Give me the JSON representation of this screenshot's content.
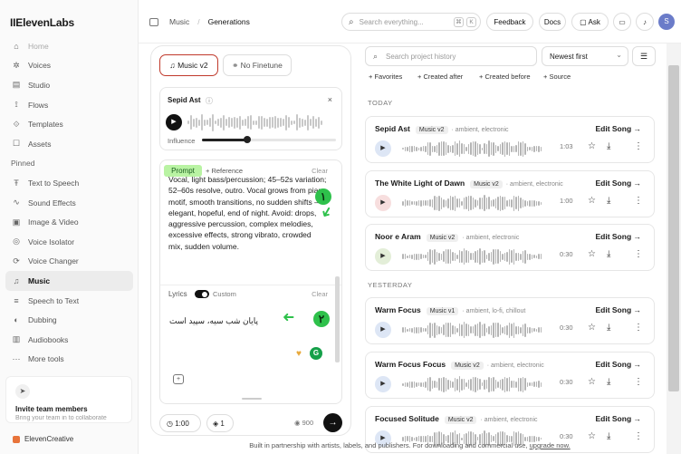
{
  "sidebar": {
    "logo": "IIElevenLabs",
    "items": [
      {
        "label": "Home",
        "icon": "home-icon",
        "glyph": "⌂",
        "dim": true
      },
      {
        "label": "Voices",
        "icon": "voices-icon",
        "glyph": "✲"
      },
      {
        "label": "Studio",
        "icon": "studio-icon",
        "glyph": "▤"
      },
      {
        "label": "Flows",
        "icon": "flows-icon",
        "glyph": "⟟"
      },
      {
        "label": "Templates",
        "icon": "templates-icon",
        "glyph": "⟐"
      },
      {
        "label": "Assets",
        "icon": "assets-icon",
        "glyph": "☐"
      }
    ],
    "pinned_label": "Pinned",
    "pinned": [
      {
        "label": "Text to Speech",
        "icon": "text-to-speech-icon",
        "glyph": "Ŧ"
      },
      {
        "label": "Sound Effects",
        "icon": "sound-effects-icon",
        "glyph": "∿"
      },
      {
        "label": "Image & Video",
        "icon": "image-video-icon",
        "glyph": "▣"
      },
      {
        "label": "Voice Isolator",
        "icon": "voice-isolator-icon",
        "glyph": "◎"
      },
      {
        "label": "Voice Changer",
        "icon": "voice-changer-icon",
        "glyph": "⟳"
      },
      {
        "label": "Music",
        "icon": "music-icon",
        "glyph": "♫",
        "active": true
      },
      {
        "label": "Speech to Text",
        "icon": "speech-to-text-icon",
        "glyph": "≡"
      },
      {
        "label": "Dubbing",
        "icon": "dubbing-icon",
        "glyph": "◐"
      },
      {
        "label": "Audiobooks",
        "icon": "audiobooks-icon",
        "glyph": "▥"
      },
      {
        "label": "More tools",
        "icon": "more-tools-icon",
        "glyph": "⋯"
      }
    ],
    "invite_title": "Invite team members",
    "invite_sub": "Bring your team in to collaborate",
    "workspace": "ElevenCreative"
  },
  "topbar": {
    "crumb_parent": "Music",
    "crumb_current": "Generations",
    "search_placeholder": "Search everything...",
    "kbd1": "⌘",
    "kbd2": "K",
    "feedback": "Feedback",
    "docs": "Docs",
    "ask": "Ask",
    "avatar": "S"
  },
  "composer": {
    "model_label": "Music v2",
    "finetune_label": "No Finetune",
    "reference_title": "Sepid Ast",
    "influence_label": "Influence",
    "influence_value": 0.34,
    "prompt_tab": "Prompt",
    "reference_tab": "+ Reference",
    "clear": "Clear",
    "prompt_text": "Vocal, light bass/percussion; 45–52s variation; 52–60s resolve, outro. Vocal grows from piano motif, smooth transitions, no sudden shifts — elegant, hopeful, end of night. Avoid: drops, aggressive percussion, complex melodies, excessive effects, strong vibrato, crowded mix, sudden volume.",
    "lyrics_label": "Lyrics",
    "custom_label": "Custom",
    "lyrics_clear": "Clear",
    "lyrics_text": "پایان شب سیه، سپید است",
    "annotation1": "۱",
    "annotation2": "۲",
    "duration": "1:00",
    "variants": "1",
    "credits": "900",
    "accent": "#2ec14b"
  },
  "history": {
    "search_placeholder": "Search project history",
    "sort": "Newest first",
    "filters": [
      "+ Favorites",
      "+ Created after",
      "+ Created before",
      "+ Source"
    ],
    "sections": [
      {
        "label": "TODAY",
        "items": [
          {
            "title": "Sepid Ast",
            "badge": "Music v2",
            "tags": "· ambient, electronic",
            "duration": "1:03",
            "edit": "Edit Song →",
            "tint": "#dde6f5"
          },
          {
            "title": "The White Light of Dawn",
            "badge": "Music v2",
            "tags": "· ambient, electronic",
            "duration": "1:00",
            "edit": "Edit Song →",
            "tint": "#f7dede"
          },
          {
            "title": "Noor e Aram",
            "badge": "Music v2",
            "tags": "· ambient, electronic",
            "duration": "0:30",
            "edit": "Edit Song →",
            "tint": "#e3eed8"
          }
        ]
      },
      {
        "label": "YESTERDAY",
        "items": [
          {
            "title": "Warm Focus",
            "badge": "Music v1",
            "tags": "· ambient, lo-fi, chillout",
            "duration": "0:30",
            "edit": "Edit Song →",
            "tint": "#dde6f5"
          },
          {
            "title": "Warm Focus Focus",
            "badge": "Music v2",
            "tags": "· ambient, electronic",
            "duration": "0:30",
            "edit": "Edit Song →",
            "tint": "#dde6f5"
          },
          {
            "title": "Focused Solitude",
            "badge": "Music v2",
            "tags": "· ambient, electronic",
            "duration": "0:30",
            "edit": "Edit Song →",
            "tint": "#dde6f5"
          }
        ]
      }
    ]
  },
  "footer": {
    "text": "Built in partnership with artists, labels, and publishers. For downloading and commercial use,",
    "link": "upgrade now."
  }
}
